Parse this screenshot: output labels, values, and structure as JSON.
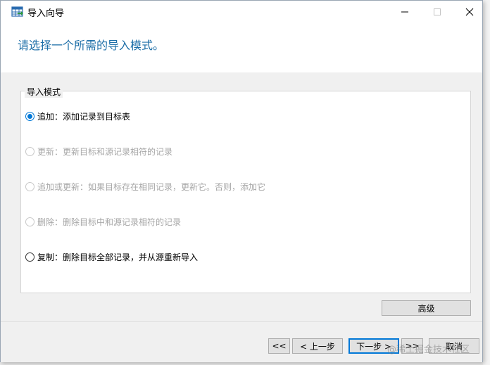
{
  "window": {
    "title": "导入向导",
    "accent": "#1e6fa8"
  },
  "header": {
    "title": "请选择一个所需的导入模式。"
  },
  "group": {
    "legend": "导入模式",
    "options": [
      {
        "label": "追加：添加记录到目标表",
        "checked": true,
        "enabled": true
      },
      {
        "label": "更新：更新目标和源记录相符的记录",
        "checked": false,
        "enabled": false
      },
      {
        "label": "追加或更新：如果目标存在相同记录，更新它。否则，添加它",
        "checked": false,
        "enabled": false
      },
      {
        "label": "删除：删除目标中和源记录相符的记录",
        "checked": false,
        "enabled": false
      },
      {
        "label": "复制：删除目标全部记录，并从源重新导入",
        "checked": false,
        "enabled": true
      }
    ]
  },
  "buttons": {
    "advanced": "高级",
    "first": "<<",
    "prev": "< 上一步",
    "next": "下一步 >",
    "last": ">>",
    "cancel": "取消"
  },
  "watermark": "@稀土掘金技术社区"
}
